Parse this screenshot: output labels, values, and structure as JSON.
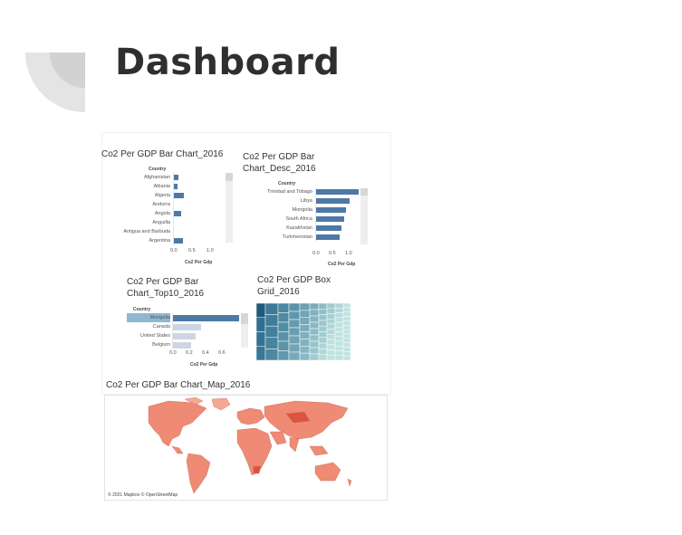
{
  "page": {
    "title": "Dashboard"
  },
  "sheets": {
    "bar_chart": {
      "title": "Co2 Per GDP Bar Chart_2016",
      "column_header": "Country",
      "axis_caption": "Co2 Per Gdp",
      "ticks": [
        "0.0",
        "0.5",
        "1.0"
      ],
      "rows": [
        {
          "label": "Afghanistan",
          "value": 0.15
        },
        {
          "label": "Albania",
          "value": 0.13
        },
        {
          "label": "Algeria",
          "value": 0.28
        },
        {
          "label": "Andorra",
          "value": 0.0
        },
        {
          "label": "Angola",
          "value": 0.22
        },
        {
          "label": "Anguilla",
          "value": 0.0
        },
        {
          "label": "Antigua and Barbuda",
          "value": 0.0
        },
        {
          "label": "Argentina",
          "value": 0.25
        }
      ]
    },
    "bar_chart_desc": {
      "title_line1": "Co2 Per GDP Bar",
      "title_line2": "Chart_Desc_2016",
      "column_header": "Country",
      "axis_caption": "Co2 Per Gdp",
      "ticks": [
        "0.0",
        "0.5",
        "1.0"
      ],
      "rows": [
        {
          "label": "Trinidad and Tobago",
          "value": 1.0
        },
        {
          "label": "Libya",
          "value": 0.8
        },
        {
          "label": "Mongolia",
          "value": 0.7
        },
        {
          "label": "South Africa",
          "value": 0.66
        },
        {
          "label": "Kazakhstan",
          "value": 0.6
        },
        {
          "label": "Turkmenistan",
          "value": 0.56
        }
      ]
    },
    "bar_chart_top10": {
      "title_line1": "Co2 Per GDP Bar",
      "title_line2": "Chart_Top10_2016",
      "column_header": "Country",
      "axis_caption": "Co2 Per Gdp",
      "ticks": [
        "0.0",
        "0.2",
        "0.4",
        "0.6"
      ],
      "rows": [
        {
          "label": "Mongolia",
          "value": 0.7,
          "highlight": true
        },
        {
          "label": "Canada",
          "value": 0.3
        },
        {
          "label": "United States",
          "value": 0.25
        },
        {
          "label": "Belgium",
          "value": 0.2
        }
      ]
    },
    "box_grid": {
      "title_line1": "Co2 Per GDP Box",
      "title_line2": "Grid_2016"
    },
    "map": {
      "title": "Co2 Per GDP Bar Chart_Map_2016",
      "credit": "© 2021 Mapbox © OpenStreetMap"
    }
  },
  "colors": {
    "bar": "#4e79a7",
    "bar_muted": "#cdd6e3",
    "highlight_row": "#8fb8d0",
    "treemap_dark": "#2b6c8f",
    "treemap_light": "#bfe3e1",
    "map_fill": "#ef8a74",
    "map_dark": "#d9553f"
  }
}
